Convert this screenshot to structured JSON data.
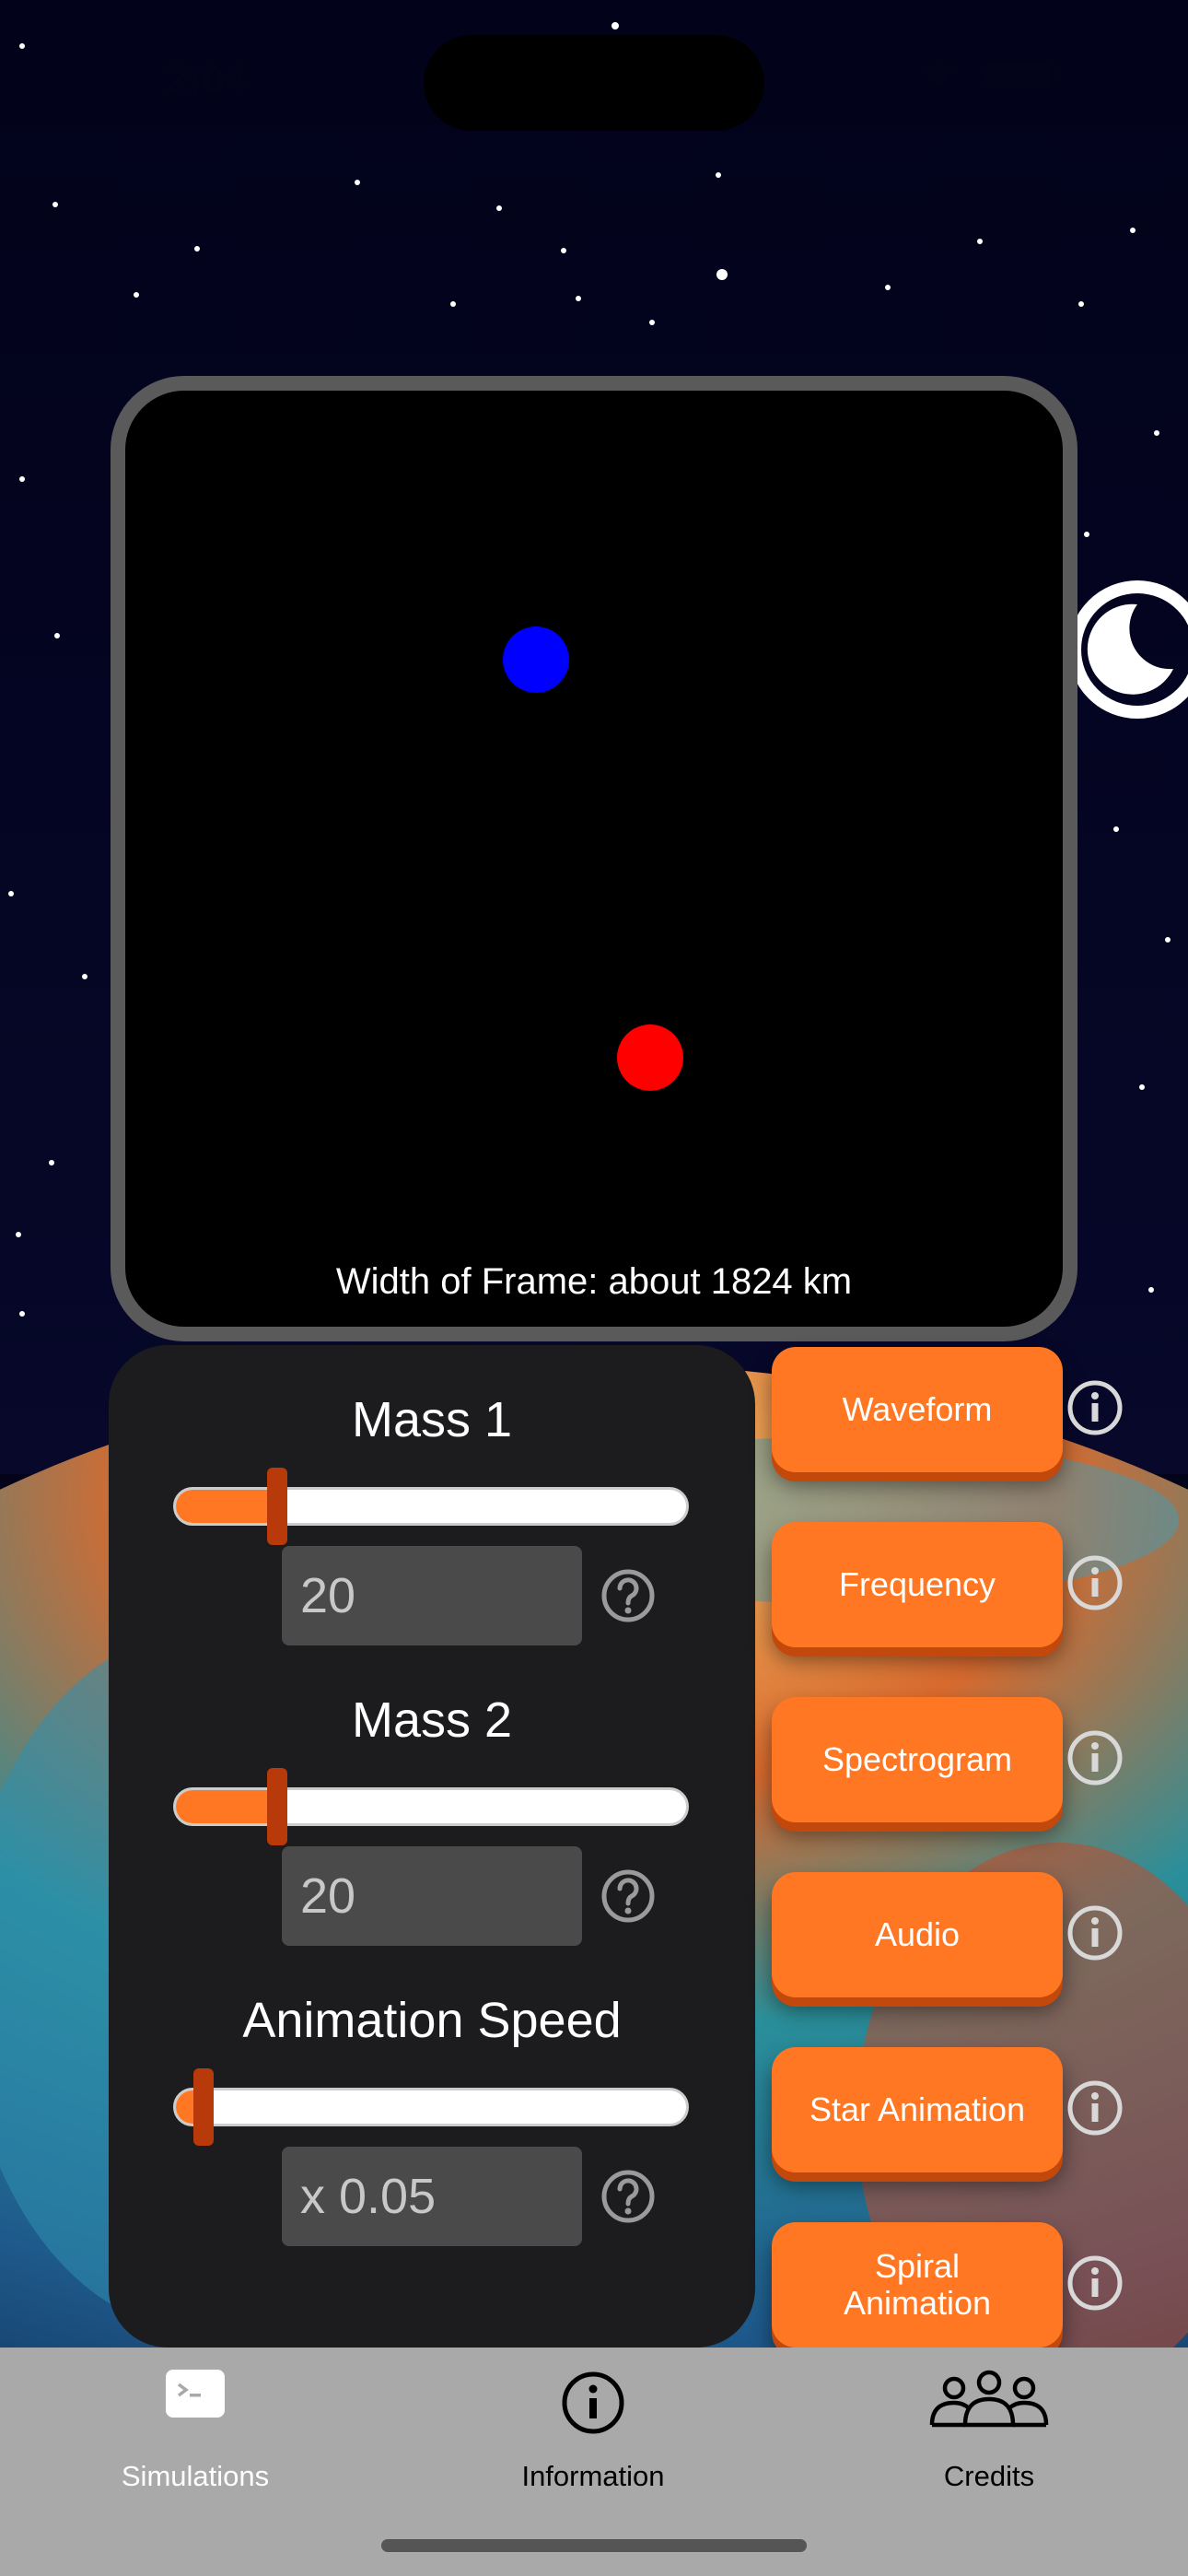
{
  "status_bar": {
    "time": "2:04"
  },
  "simulation": {
    "frame_label": "Width of Frame: about 1824 km",
    "colors": {
      "mass1": "#0000ff",
      "mass2": "#ff0000",
      "frame_border": "#5a5a5a"
    }
  },
  "controls": {
    "mass1": {
      "title": "Mass 1",
      "value": "20",
      "slider_fraction": 0.19
    },
    "mass2": {
      "title": "Mass 2",
      "value": "20",
      "slider_fraction": 0.19
    },
    "speed": {
      "title": "Animation Speed",
      "value": "x 0.05",
      "slider_fraction": 0.05
    },
    "accent_color": "#ff7722"
  },
  "actions": [
    {
      "label": "Waveform"
    },
    {
      "label": "Frequency"
    },
    {
      "label": "Spectrogram"
    },
    {
      "label": "Audio"
    },
    {
      "label": "Star Animation"
    },
    {
      "label": "Spiral Animation"
    }
  ],
  "icons": {
    "theme": "moon-icon",
    "help": "question-circle-icon",
    "info": "info-circle-icon"
  },
  "tab_bar": {
    "tabs": [
      {
        "label": "Simulations",
        "icon": "terminal-icon",
        "selected": true
      },
      {
        "label": "Information",
        "icon": "info-circle-icon",
        "selected": false
      },
      {
        "label": "Credits",
        "icon": "people-icon",
        "selected": false
      }
    ]
  }
}
